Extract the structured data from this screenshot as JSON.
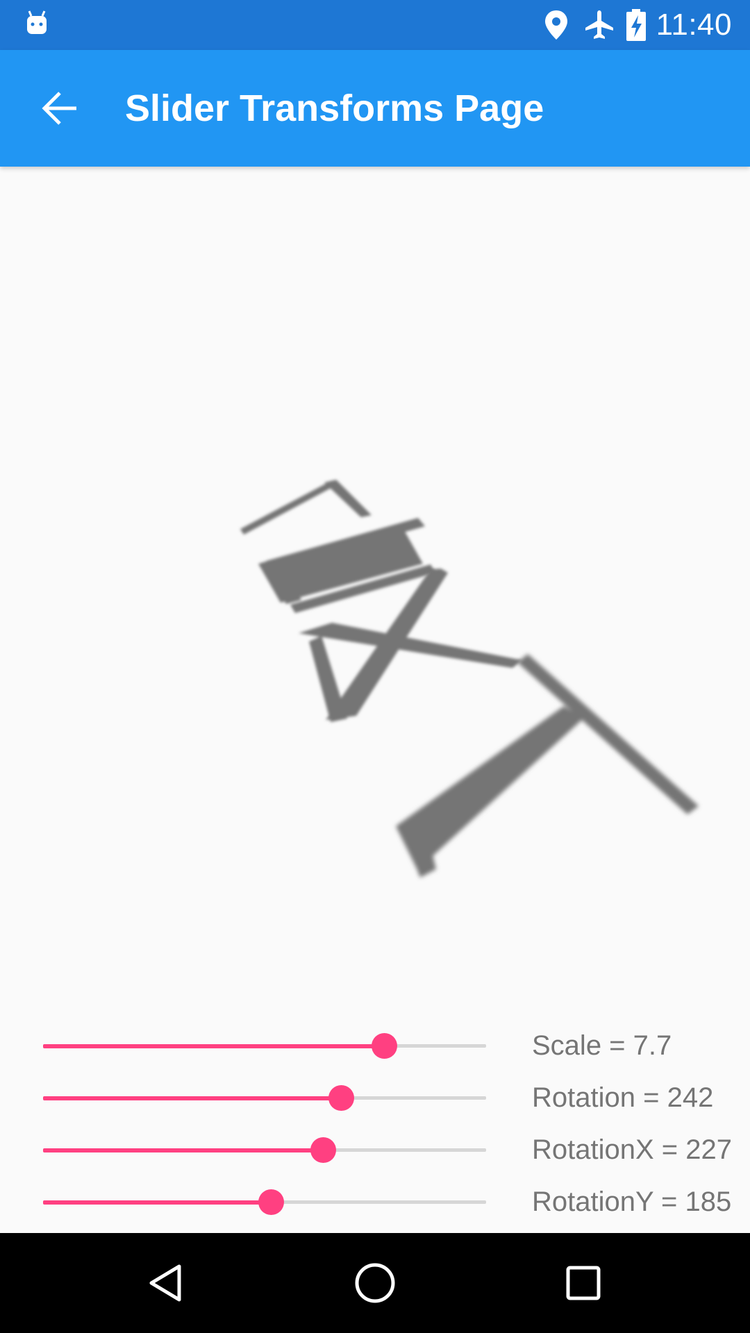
{
  "status_bar": {
    "time": "11:40",
    "left_icon": "android-icon",
    "right_icons": [
      "location-icon",
      "airplane-icon",
      "battery-charging-icon"
    ]
  },
  "app_bar": {
    "title": "Slider Transforms Page",
    "back_icon": "arrow-back-icon"
  },
  "transformed_text": {
    "letters": [
      "T",
      "E",
      "X",
      "T"
    ],
    "color": "#757575"
  },
  "sliders": [
    {
      "name": "scale",
      "label": "Scale = 7.7",
      "fraction": 0.77
    },
    {
      "name": "rotation",
      "label": "Rotation = 242",
      "fraction": 0.672
    },
    {
      "name": "rotation-x",
      "label": "RotationX = 227",
      "fraction": 0.631
    },
    {
      "name": "rotation-y",
      "label": "RotationY = 185",
      "fraction": 0.514
    }
  ],
  "nav_bar": {
    "buttons": [
      "nav-back-icon",
      "nav-home-icon",
      "nav-recents-icon"
    ]
  },
  "colors": {
    "status_bar": "#1e77d4",
    "app_bar": "#2196f3",
    "accent": "#ff4081",
    "track": "#d6d6d6",
    "label_text": "#757575",
    "background": "#fafafa"
  }
}
